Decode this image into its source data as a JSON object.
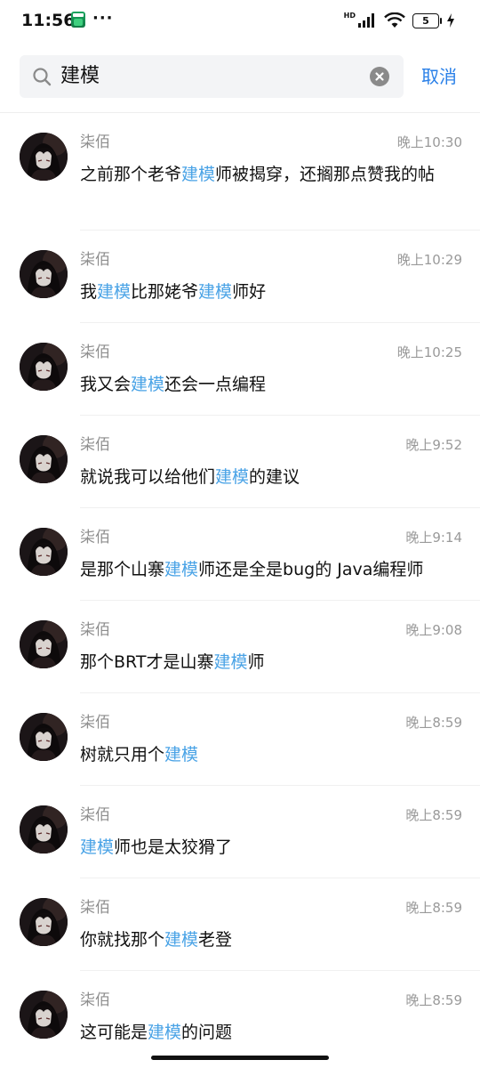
{
  "statusbar": {
    "time": "11:56",
    "more": "···",
    "network": "HD",
    "battery": "5"
  },
  "search": {
    "query": "建模",
    "cancel_label": "取消"
  },
  "colors": {
    "highlight": "#4aa3e6",
    "accent": "#2a80e8"
  },
  "results": [
    {
      "name": "柒佰",
      "time": "晚上10:30",
      "segments": [
        "之前那个老爷",
        "建模",
        "师被揭穿，还搁那点赞我的帖"
      ]
    },
    {
      "name": "柒佰",
      "time": "晚上10:29",
      "segments": [
        "我",
        "建模",
        "比那姥爷",
        "建模",
        "师好"
      ]
    },
    {
      "name": "柒佰",
      "time": "晚上10:25",
      "segments": [
        "我又会",
        "建模",
        "还会一点编程"
      ]
    },
    {
      "name": "柒佰",
      "time": "晚上9:52",
      "segments": [
        "就说我可以给他们",
        "建模",
        "的建议"
      ]
    },
    {
      "name": "柒佰",
      "time": "晚上9:14",
      "segments": [
        "是那个山寨",
        "建模",
        "师还是全是bug的 Java编程师"
      ]
    },
    {
      "name": "柒佰",
      "time": "晚上9:08",
      "segments": [
        "那个BRT才是山寨",
        "建模",
        "师"
      ]
    },
    {
      "name": "柒佰",
      "time": "晚上8:59",
      "segments": [
        "树就只用个",
        "建模"
      ]
    },
    {
      "name": "柒佰",
      "time": "晚上8:59",
      "segments": [
        "",
        "建模",
        "师也是太狡猾了"
      ]
    },
    {
      "name": "柒佰",
      "time": "晚上8:59",
      "segments": [
        "你就找那个",
        "建模",
        "老登"
      ]
    },
    {
      "name": "柒佰",
      "time": "晚上8:59",
      "segments": [
        "这可能是",
        "建模",
        "的问题"
      ]
    }
  ]
}
